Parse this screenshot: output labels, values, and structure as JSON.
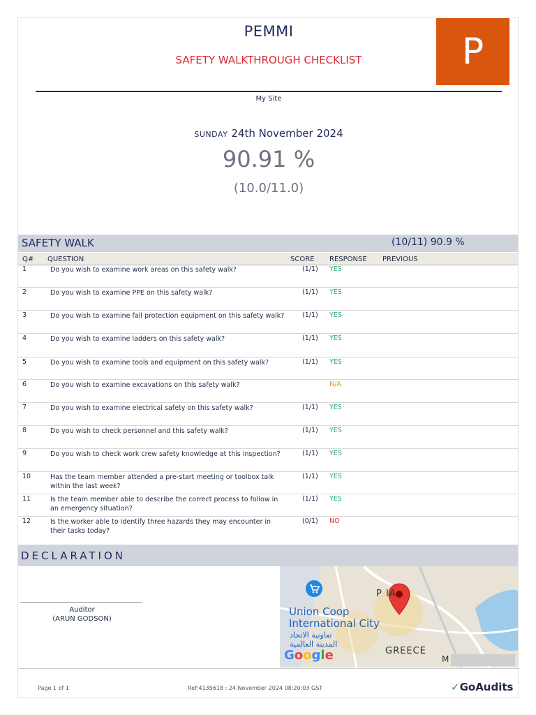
{
  "header": {
    "org": "PEMMI",
    "title": "SAFETY WALKTHROUGH CHECKLIST",
    "logo_letter": "P",
    "site": "My Site",
    "day": "SUNDAY",
    "date": "24th November 2024",
    "percent": "90.91 %",
    "fraction": "(10.0/11.0)"
  },
  "colors": {
    "accent_navy": "#1f2a5a",
    "accent_red": "#d62b33",
    "logo_orange": "#d9560f",
    "yes_green": "#2aa876",
    "na_orange": "#e89a1f",
    "no_red": "#d62b33"
  },
  "section": {
    "name": "SAFETY WALK",
    "score": "(10/11) 90.9 %",
    "columns": {
      "q": "Q#",
      "question": "QUESTION",
      "score": "SCORE",
      "response": "RESPONSE",
      "previous": "PREVIOUS"
    },
    "rows": [
      {
        "n": "1",
        "q": "Do you wish to examine work areas on this safety walk?",
        "score": "(1/1)",
        "response": "YES",
        "status": "yes"
      },
      {
        "n": "2",
        "q": "Do you wish to examine PPE on this safety walk?",
        "score": "(1/1)",
        "response": "YES",
        "status": "yes"
      },
      {
        "n": "3",
        "q": "Do you wish to examine fall protection equipment on this safety walk?",
        "score": "(1/1)",
        "response": "YES",
        "status": "yes"
      },
      {
        "n": "4",
        "q": "Do you wish to examine ladders on this safety walk?",
        "score": "(1/1)",
        "response": "YES",
        "status": "yes"
      },
      {
        "n": "5",
        "q": "Do you wish to examine tools and equipment on this safety walk?",
        "score": "(1/1)",
        "response": "YES",
        "status": "yes"
      },
      {
        "n": "6",
        "q": "Do you wish to examine excavations on this safety walk?",
        "score": "",
        "response": "N/A",
        "status": "na"
      },
      {
        "n": "7",
        "q": "Do you wish to examine electrical safety on this safety walk?",
        "score": "(1/1)",
        "response": "YES",
        "status": "yes"
      },
      {
        "n": "8",
        "q": "Do you wish to check personnel and this safety walk?",
        "score": "(1/1)",
        "response": "YES",
        "status": "yes"
      },
      {
        "n": "9",
        "q": "Do you wish to check work crew safety knowledge at this inspection?",
        "score": "(1/1)",
        "response": "YES",
        "status": "yes"
      },
      {
        "n": "10",
        "q": "Has the team member attended a pre-start meeting or toolbox talk within the last week?",
        "score": "(1/1)",
        "response": "YES",
        "status": "yes"
      },
      {
        "n": "11",
        "q": "Is the team member able to describe the correct process to follow in an emergency situation?",
        "score": "(1/1)",
        "response": "YES",
        "status": "yes"
      },
      {
        "n": "12",
        "q": "Is the worker able to identify three hazards they may encounter in their tasks today?",
        "score": "(0/1)",
        "response": "NO",
        "status": "no"
      }
    ]
  },
  "declaration": {
    "title": "DECLARATION",
    "role": "Auditor",
    "person": "(ARUN GODSON)"
  },
  "map": {
    "place_en": "Union Coop International City",
    "place_en_line1": "Union Coop",
    "place_en_line2": "International City",
    "place_ar_line1": "تعاونية الاتحاد",
    "place_ar_line2": "المدينة العالمية",
    "label_greece": "GREECE",
    "label_persia": "P    IA",
    "label_m": "M",
    "google": "Google",
    "pin_icon": "map-pin-icon",
    "cart_icon": "shopping-cart-icon"
  },
  "footer": {
    "page": "Page 1 of 1",
    "ref": "Ref:4135618 : 24.November 2024 08:20:03 GST",
    "brand": "GoAudits"
  }
}
